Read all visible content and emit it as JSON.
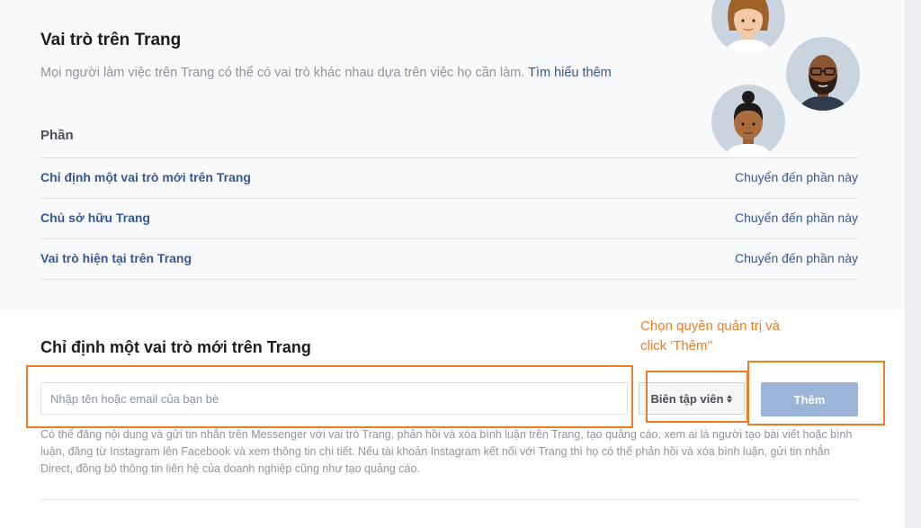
{
  "header": {
    "title": "Vai trò trên Trang",
    "subtitle": "Mọi người làm việc trên Trang có thể có vai trò khác nhau dựa trên việc họ cần làm.",
    "learn_more": "Tìm hiểu thêm"
  },
  "parts": {
    "heading": "Phần",
    "items": [
      {
        "label": "Chỉ định một vai trò mới trên Trang",
        "action": "Chuyển đến phần này"
      },
      {
        "label": "Chủ sở hữu Trang",
        "action": "Chuyển đến phần này"
      },
      {
        "label": "Vai trò hiện tại trên Trang",
        "action": "Chuyển đến phần này"
      }
    ]
  },
  "assign": {
    "title": "Chỉ định một vai trò mới trên Trang",
    "input_placeholder": "Nhập tên hoặc email của bạn bè",
    "input_value": "",
    "role_selected": "Biên tập viên",
    "add_label": "Thêm",
    "description": "Có thể đăng nội dung và gửi tin nhắn trên Messenger với vai trò Trang, phản hồi và xóa bình luận trên Trang, tạo quảng cáo, xem ai là người tạo bài viết hoặc bình luận, đăng từ Instagram lên Facebook và xem thông tin chi tiết. Nếu tài khoản Instagram kết nối với Trang thì họ có thể phản hồi và xóa bình luận, gửi tin nhắn Direct, đồng bộ thông tin liên hệ của doanh nghiệp cũng như tạo quảng cáo."
  },
  "annotation": {
    "text": "Chọn quyền quản trị và\nclick 'Thêm''",
    "color": "#f47b20"
  },
  "colors": {
    "link": "#365899",
    "panel_bg": "#f8f9fa",
    "button_disabled": "#9cb4d8",
    "highlight": "#f47b20"
  }
}
